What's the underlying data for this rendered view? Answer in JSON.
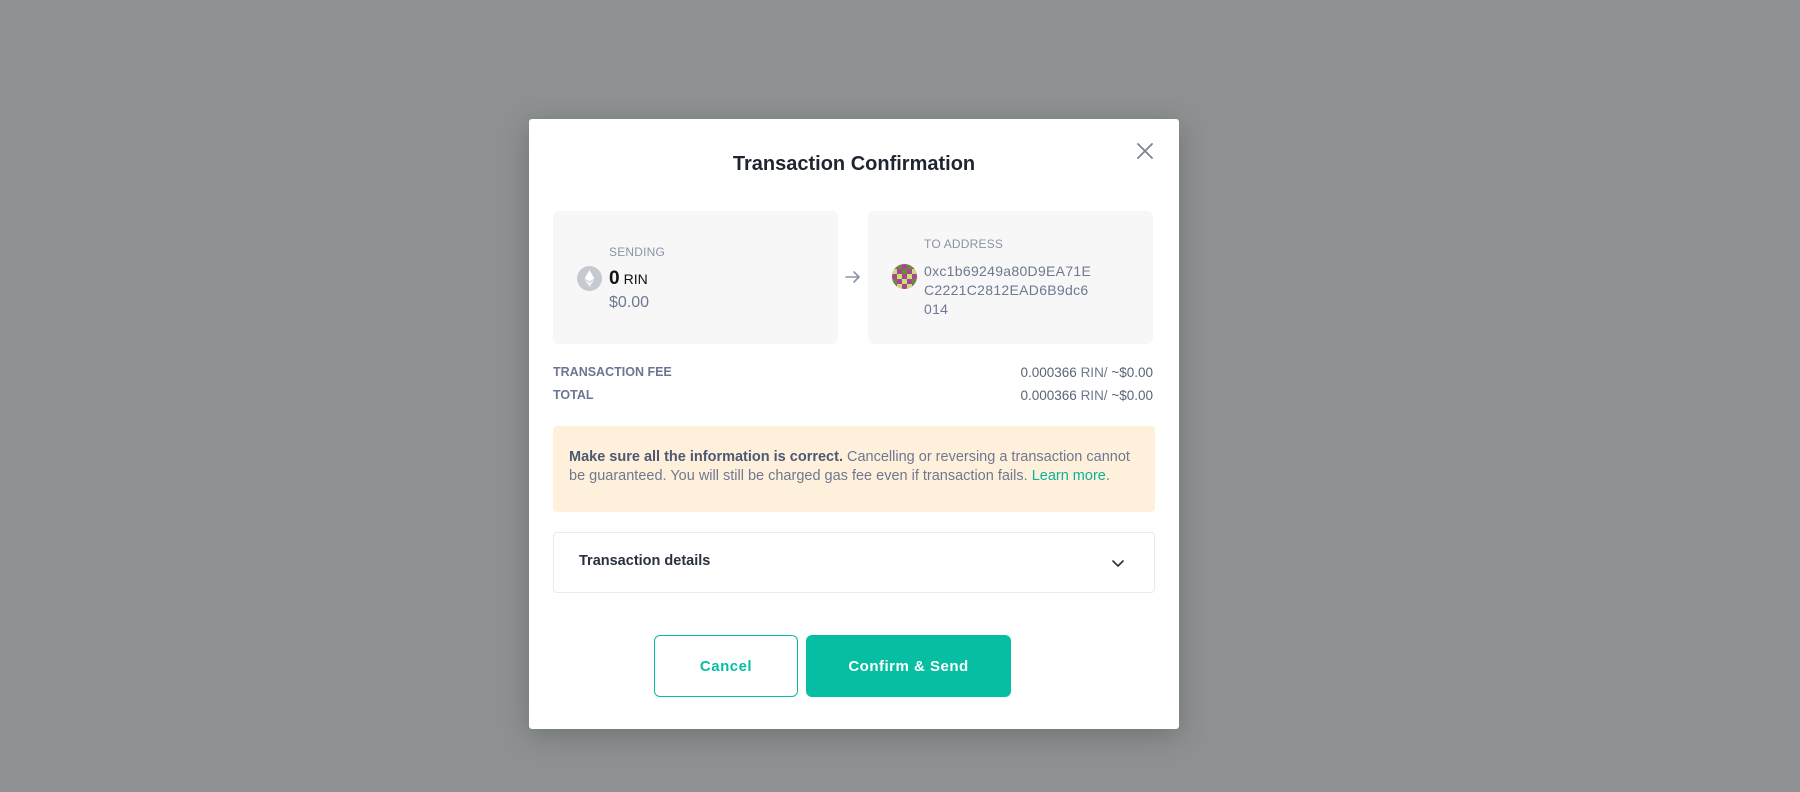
{
  "modal": {
    "title": "Transaction Confirmation"
  },
  "sending": {
    "label": "SENDING",
    "amount": "0",
    "unit": "RIN",
    "fiat": "$0.00",
    "icon": "ethereum-icon"
  },
  "to": {
    "label": "TO ADDRESS",
    "address_line1": "0xc1b69249a80D9EA71E",
    "address_line2": "C2221C2812EAD6B9dc6",
    "address_line3": "014",
    "icon": "identicon-avatar"
  },
  "fee": {
    "label": "TRANSACTION FEE",
    "amount": "0.000366",
    "unit": "RIN/",
    "fiat": "~$0.00"
  },
  "total": {
    "label": "TOTAL",
    "amount": "0.000366",
    "unit": "RIN/",
    "fiat": "~$0.00"
  },
  "warning": {
    "bold": "Make sure all the information is correct.",
    "text": "Cancelling or reversing a transaction cannot be guaranteed. You will still be charged gas fee even if transaction fails.",
    "link": "Learn more",
    "trailing": "."
  },
  "details": {
    "label": "Transaction details"
  },
  "buttons": {
    "cancel": "Cancel",
    "confirm": "Confirm & Send"
  },
  "colors": {
    "accent": "#06bfa3",
    "warning_bg": "#fff0dc",
    "overlay": "#8e9192"
  }
}
